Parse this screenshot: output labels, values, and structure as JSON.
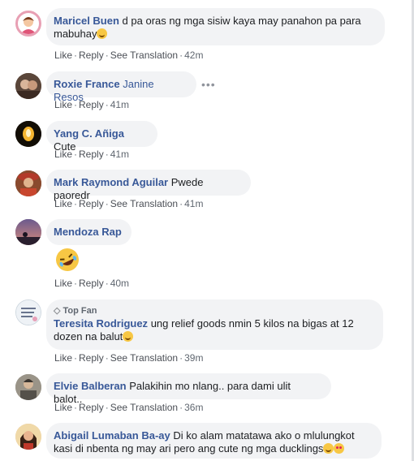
{
  "actions": {
    "like": "Like",
    "reply": "Reply",
    "translation": "See Translation",
    "sep": "·"
  },
  "badge": {
    "top_fan": "Top Fan"
  },
  "comments": [
    {
      "author": "Maricel Buen",
      "text": "d pa oras ng mga sisiw kaya may panahon pa para",
      "text2": "mabuhay",
      "time": "42m"
    },
    {
      "author": "Roxie France",
      "tag": "Janine Resos",
      "more": "•••",
      "time": "41m"
    },
    {
      "author": "Yang C. Añiga",
      "text": "Cute",
      "time": "41m"
    },
    {
      "author": "Mark Raymond Aguilar",
      "text": "Pwede paoredr",
      "time": "41m"
    },
    {
      "author": "Mendoza Rap",
      "time": "40m"
    },
    {
      "author": "Teresita Rodriguez",
      "text": "ung relief goods nmin 5 kilos na bigas at 12",
      "text2": "dozen na balut",
      "time": "39m"
    },
    {
      "author": "Elvie Balberan",
      "text": "Palakihin mo nlang.. para dami ulit balot..",
      "time": "36m"
    },
    {
      "author": "Abigail Lumaban Ba-ay",
      "text": "Di ko alam matatawa ako o mlulungkot",
      "text2": "kasi di nbenta ng may ari pero ang cute ng mga ducklings"
    }
  ]
}
